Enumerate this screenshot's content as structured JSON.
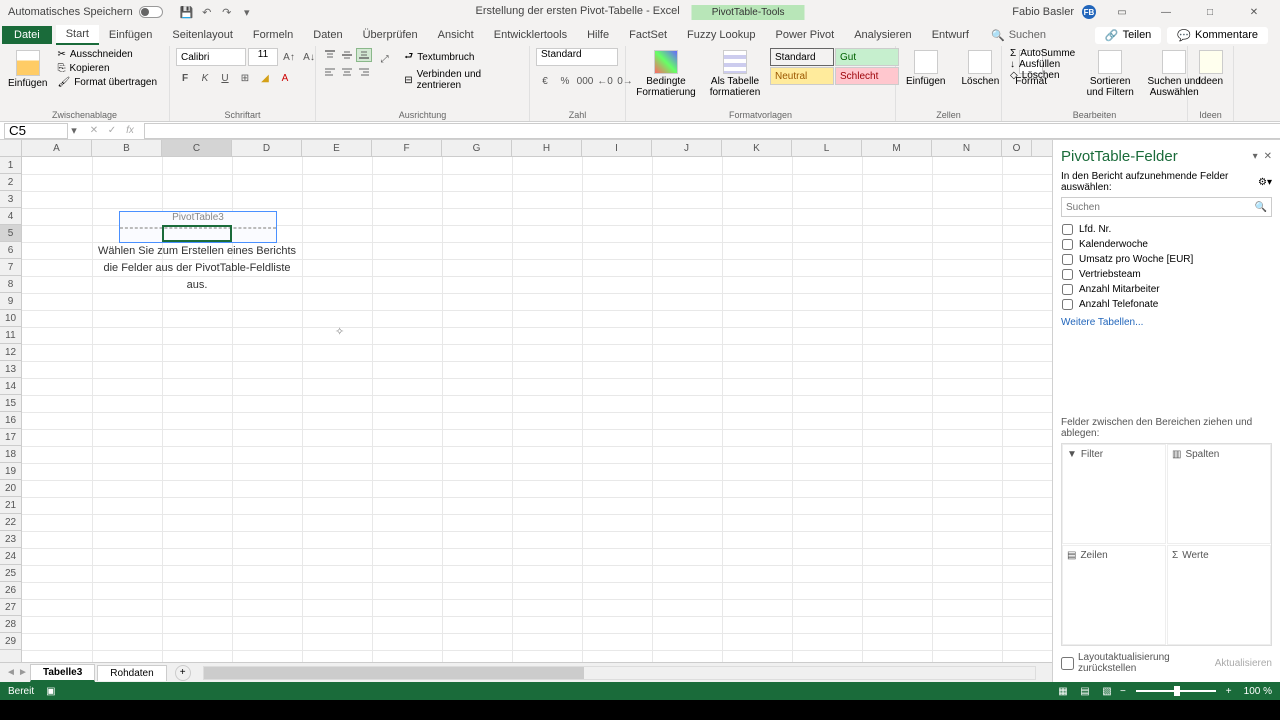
{
  "titlebar": {
    "autosave": "Automatisches Speichern",
    "doc_title": "Erstellung der ersten Pivot-Tabelle - Excel",
    "context_tools": "PivotTable-Tools",
    "user": "Fabio Basler",
    "avatar": "FB"
  },
  "tabs": {
    "file": "Datei",
    "list": [
      "Start",
      "Einfügen",
      "Seitenlayout",
      "Formeln",
      "Daten",
      "Überprüfen",
      "Ansicht",
      "Entwicklertools",
      "Hilfe",
      "FactSet",
      "Fuzzy Lookup",
      "Power Pivot",
      "Analysieren",
      "Entwurf"
    ],
    "active": "Start",
    "search": "Suchen",
    "share": "Teilen",
    "comments": "Kommentare"
  },
  "ribbon": {
    "clipboard": {
      "paste": "Einfügen",
      "cut": "Ausschneiden",
      "copy": "Kopieren",
      "painter": "Format übertragen",
      "label": "Zwischenablage"
    },
    "font": {
      "name": "Calibri",
      "size": "11",
      "label": "Schriftart"
    },
    "align": {
      "wrap": "Textumbruch",
      "merge": "Verbinden und zentrieren",
      "label": "Ausrichtung"
    },
    "number": {
      "format": "Standard",
      "label": "Zahl"
    },
    "styles": {
      "cond": "Bedingte Formatierung",
      "table": "Als Tabelle formatieren",
      "std": "Standard",
      "gut": "Gut",
      "neu": "Neutral",
      "bad": "Schlecht",
      "label": "Formatvorlagen"
    },
    "cells": {
      "insert": "Einfügen",
      "delete": "Löschen",
      "format": "Format",
      "label": "Zellen"
    },
    "edit": {
      "sum": "AutoSumme",
      "fill": "Ausfüllen",
      "clear": "Löschen",
      "sort": "Sortieren und Filtern",
      "find": "Suchen und Auswählen",
      "label": "Bearbeiten"
    },
    "ideas": {
      "name": "Ideen",
      "label": "Ideen"
    }
  },
  "namebox": "C5",
  "pivot": {
    "header": "PivotTable3",
    "msg": "Wählen Sie zum Erstellen eines Berichts die Felder aus der PivotTable-Feldliste aus."
  },
  "taskpane": {
    "title": "PivotTable-Felder",
    "subtitle": "In den Bericht aufzunehmende Felder auswählen:",
    "search_ph": "Suchen",
    "fields": [
      "Lfd. Nr.",
      "Kalenderwoche",
      "Umsatz pro Woche [EUR]",
      "Vertriebsteam",
      "Anzahl Mitarbeiter",
      "Anzahl Telefonate"
    ],
    "more": "Weitere Tabellen...",
    "drop_label": "Felder zwischen den Bereichen ziehen und ablegen:",
    "filter": "Filter",
    "columns": "Spalten",
    "rows": "Zeilen",
    "values": "Werte",
    "defer": "Layoutaktualisierung zurückstellen",
    "update": "Aktualisieren"
  },
  "sheets": {
    "tabs": [
      "Tabelle3",
      "Rohdaten"
    ],
    "active": "Tabelle3"
  },
  "status": {
    "ready": "Bereit",
    "zoom": "100 %"
  },
  "cols": [
    "A",
    "B",
    "C",
    "D",
    "E",
    "F",
    "G",
    "H",
    "I",
    "J",
    "K",
    "L",
    "M",
    "N",
    "O"
  ]
}
